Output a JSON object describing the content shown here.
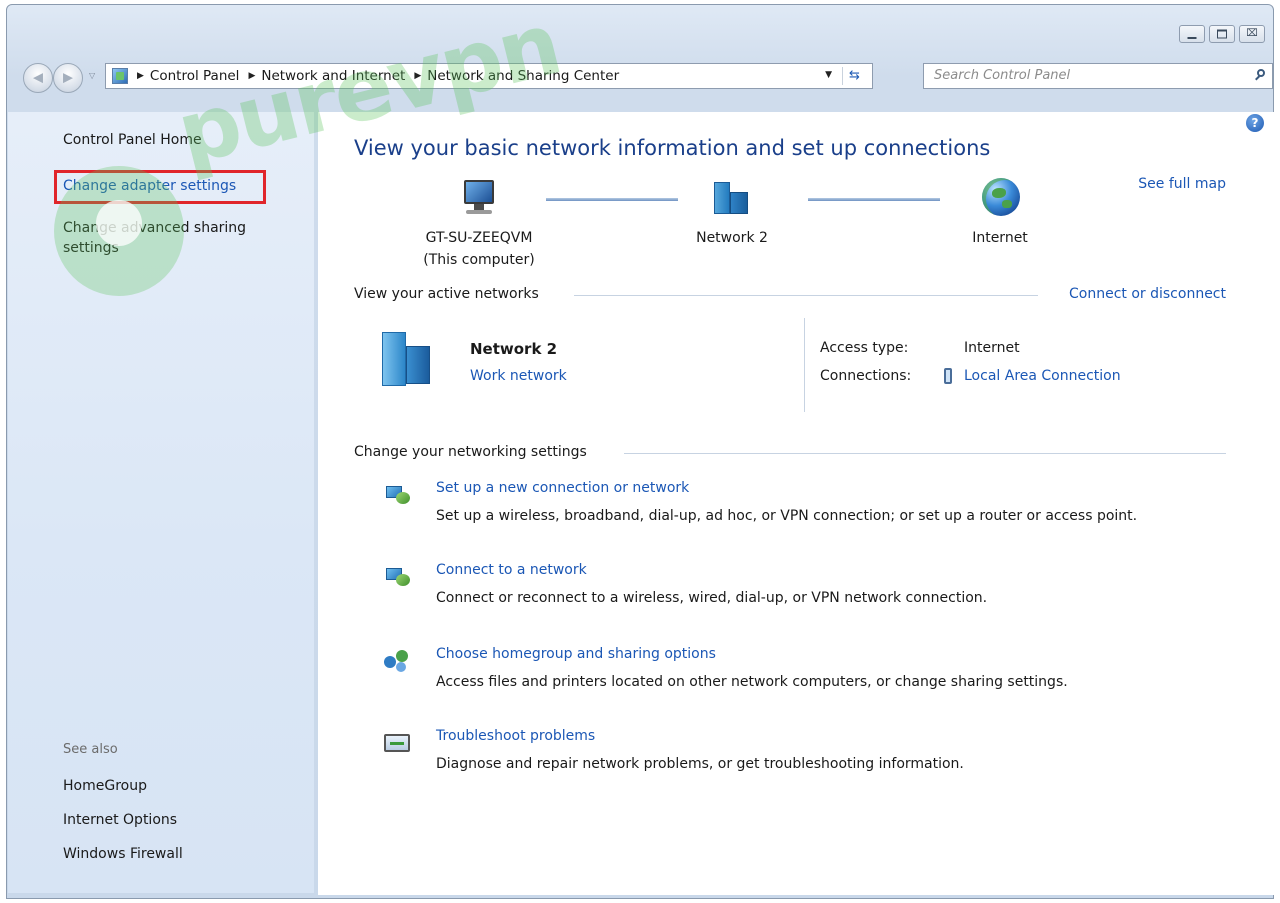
{
  "window": {
    "caption_buttons": [
      "minimize",
      "maximize",
      "close"
    ],
    "close_glyph": "⌧"
  },
  "navigation": {
    "back_glyph": "◀",
    "forward_glyph": "▶",
    "recent_glyph": "▽",
    "crumb_separator": "▶",
    "breadcrumbs": [
      "Control Panel",
      "Network and Internet",
      "Network and Sharing Center"
    ],
    "dropdown_glyph": "▼",
    "refresh_glyph": "⇆"
  },
  "search": {
    "placeholder": "Search Control Panel"
  },
  "help": {
    "glyph": "?"
  },
  "sidebar": {
    "home": "Control Panel Home",
    "links": [
      "Change adapter settings",
      "Change advanced sharing",
      "settings"
    ],
    "see_also_title": "See also",
    "see_also": [
      "HomeGroup",
      "Internet Options",
      "Windows Firewall"
    ]
  },
  "main": {
    "title": "View your basic network information and set up connections",
    "see_full_map": "See full map",
    "map": {
      "computer_name": "GT-SU-ZEEQVM",
      "computer_sub": "(This computer)",
      "network_name": "Network  2",
      "internet_name": "Internet"
    },
    "active_section": {
      "heading": "View your active networks",
      "connect_link": "Connect or disconnect",
      "network_name": "Network  2",
      "network_type": "Work network",
      "access_type_label": "Access type:",
      "access_type_value": "Internet",
      "connections_label": "Connections:",
      "connections_value": "Local Area Connection"
    },
    "change_section": {
      "heading": "Change your networking settings",
      "tasks": [
        {
          "icon": "new-connection-icon",
          "link": "Set up a new connection or network",
          "description": "Set up a wireless, broadband, dial-up, ad hoc, or VPN connection; or set up a router or access point."
        },
        {
          "icon": "connect-network-icon",
          "link": "Connect to a network",
          "description": "Connect or reconnect to a wireless, wired, dial-up, or VPN network connection."
        },
        {
          "icon": "homegroup-icon",
          "link": "Choose homegroup and sharing options",
          "description": "Access files and printers located on other network computers, or change sharing settings."
        },
        {
          "icon": "troubleshoot-icon",
          "link": "Troubleshoot problems",
          "description": "Diagnose and repair network problems, or get troubleshooting information."
        }
      ]
    }
  },
  "watermark": {
    "text": "purevpn"
  },
  "colors": {
    "link": "#1b57b5",
    "title": "#1a3f8a",
    "highlight": "#e0252b",
    "watermark": "#5cc45c"
  }
}
